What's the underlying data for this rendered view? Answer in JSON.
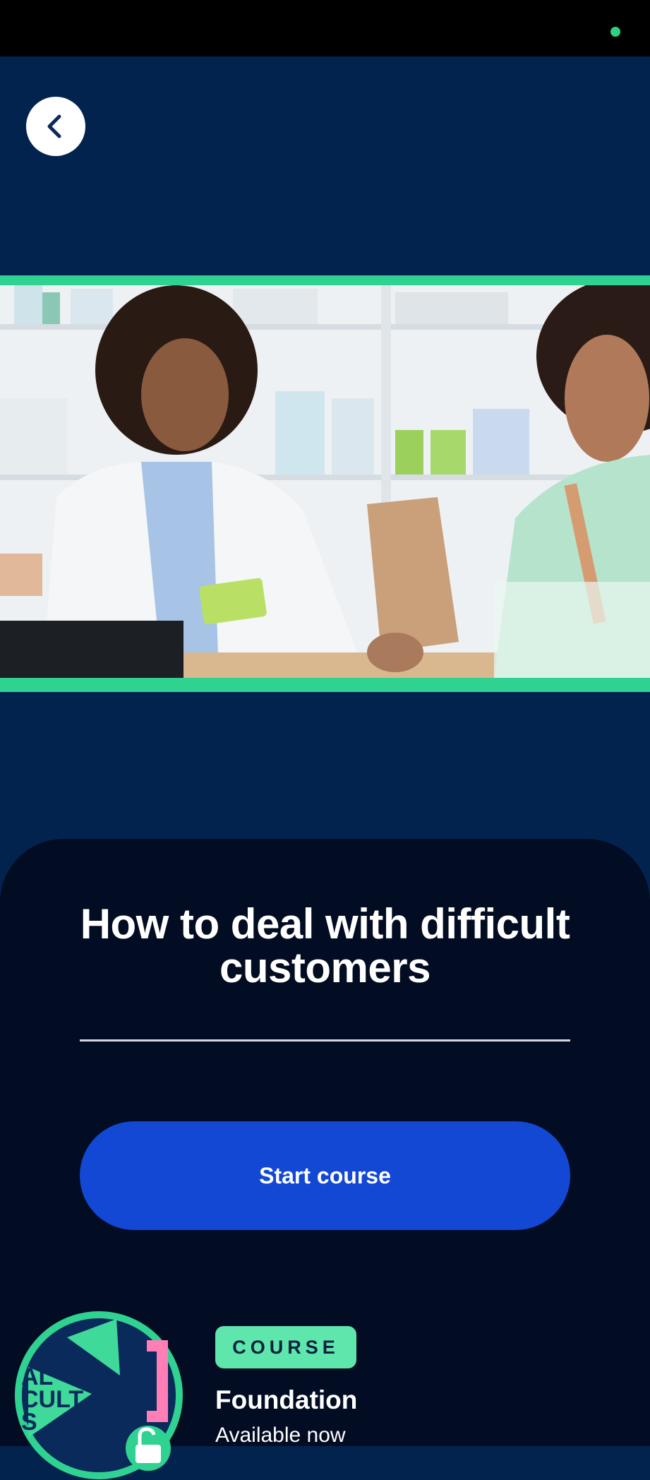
{
  "course": {
    "title": "How to deal with difficult customers",
    "start_label": "Start course",
    "tag": "COURSE",
    "level": "Foundation",
    "availability": "Available now"
  },
  "badge": {
    "text_lines": [
      "AL",
      "CULT",
      "S"
    ]
  },
  "colors": {
    "background": "#03234f",
    "card": "#020c22",
    "accent_green": "#2fd290",
    "primary_button": "#1248d4",
    "tag_bg": "#5ee6ad",
    "status_dot": "#2fd27a"
  },
  "icons": {
    "back": "chevron-left-icon",
    "status": "status-dot-icon",
    "lock": "unlock-icon"
  }
}
